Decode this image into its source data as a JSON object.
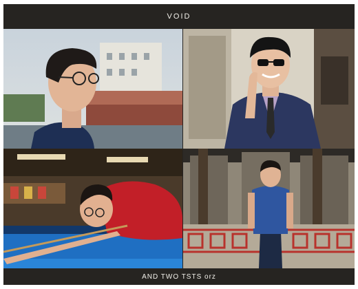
{
  "header": {
    "title": "VOID"
  },
  "footer": {
    "caption": "AND TWO TSTS orz"
  },
  "photos": [
    {
      "subject": "man in glasses, side profile, navy t-shirt, riverside buildings"
    },
    {
      "subject": "man in sunglasses and dark suit with purple tie, adjusting glasses"
    },
    {
      "subject": "man in red shirt aiming a cue at a blue billiard table"
    },
    {
      "subject": "man in blue shirt standing in front of a stone temple gate"
    }
  ],
  "colors": {
    "frame": "#262421",
    "text": "#f2f0ea"
  }
}
